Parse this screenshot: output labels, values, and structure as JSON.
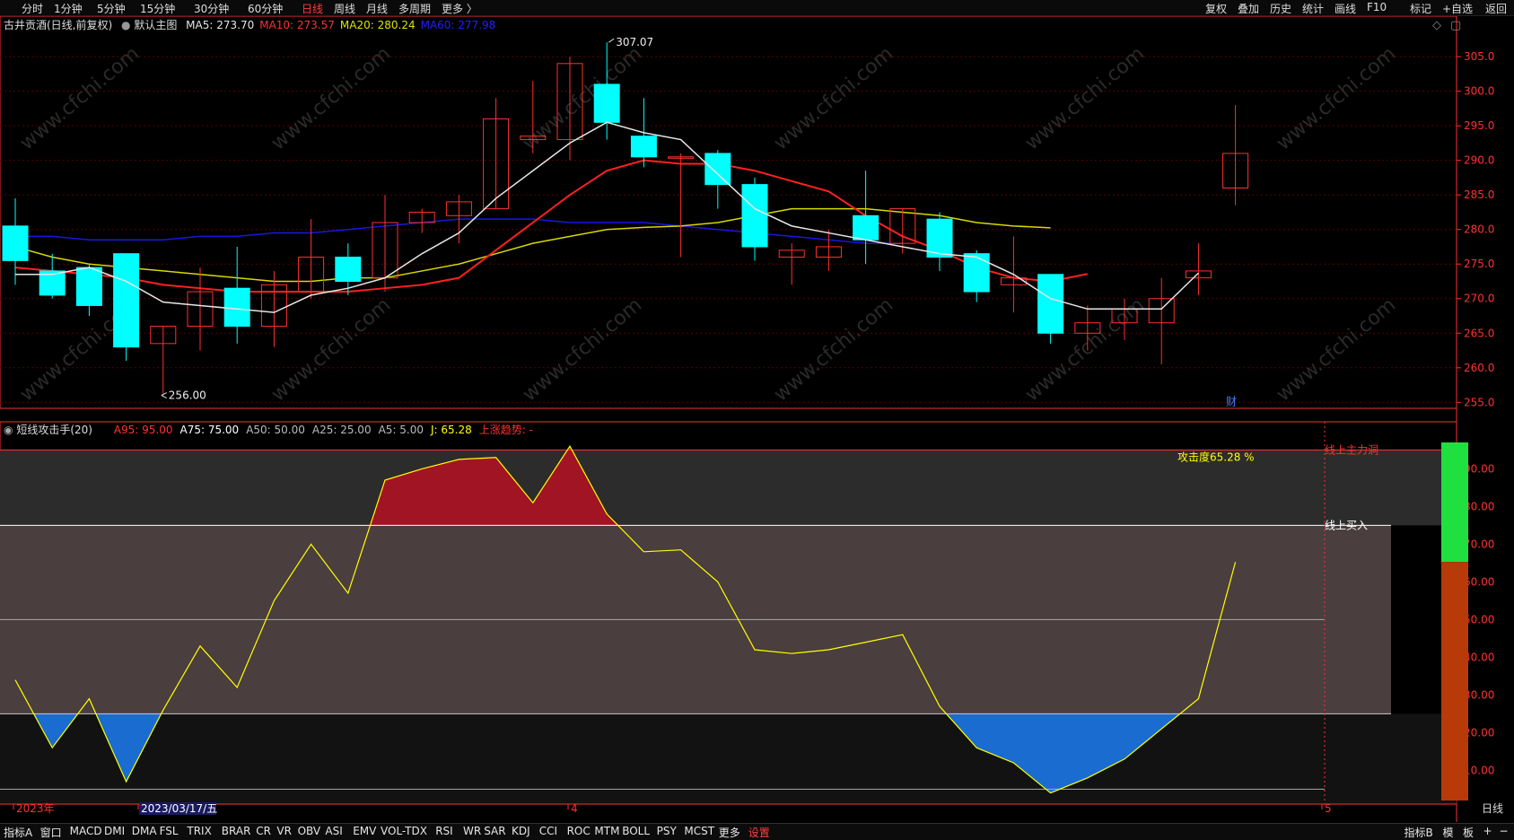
{
  "toolbar": {
    "periods": [
      "分时",
      "1分钟",
      "5分钟",
      "15分钟",
      "30分钟",
      "60分钟",
      "日线",
      "周线",
      "月线",
      "多周期",
      "更多 〉"
    ],
    "active_period": "日线",
    "right": [
      "复权",
      "叠加",
      "历史",
      "统计",
      "画线",
      "F10",
      "标记",
      "+自选",
      "返回"
    ]
  },
  "main_panel": {
    "stock_label": "古井贡酒(日线,前复权)",
    "template_label": "默认主图",
    "ma": [
      {
        "text": "MA5: 273.70",
        "color": "#e6e6e6"
      },
      {
        "text": "MA10: 273.57",
        "color": "#ff3030"
      },
      {
        "text": "MA20: 280.24",
        "color": "#e0e000"
      },
      {
        "text": "MA60: 277.98",
        "color": "#2020ff"
      }
    ],
    "high_marker": "307.07",
    "low_marker": "256.00",
    "fin_marker": "财"
  },
  "sub_panel": {
    "indicator_name": "短线攻击手(20)",
    "values": [
      {
        "text": "A95: 95.00",
        "color": "#ff3030"
      },
      {
        "text": "A75: 75.00",
        "color": "#ffffff"
      },
      {
        "text": "A50: 50.00",
        "color": "#bbbbbb"
      },
      {
        "text": "A25: 25.00",
        "color": "#bbbbbb"
      },
      {
        "text": "A5: 5.00",
        "color": "#bbbbbb"
      },
      {
        "text": "J: 65.28",
        "color": "#ffff00"
      },
      {
        "text": "上涨趋势: -",
        "color": "#ff3030"
      }
    ],
    "attack_label": "攻击度65.28 %",
    "buy_label": "线上买入",
    "top_label": "线上主力洞"
  },
  "date_axis": {
    "labels": [
      {
        "text": "2023年",
        "color": "#ff3030"
      },
      {
        "text": "2023/03/17/五",
        "color": "#ffffff"
      },
      {
        "text": "4",
        "color": "#ff3030"
      },
      {
        "text": "5",
        "color": "#ff3030"
      }
    ],
    "right_label": "日线"
  },
  "indicator_tabs": {
    "items": [
      "指标A",
      "窗口",
      "MACD",
      "DMI",
      "DMA",
      "FSL",
      "TRIX",
      "BRAR",
      "CR",
      "VR",
      "OBV",
      "ASI",
      "EMV",
      "VOL-TDX",
      "RSI",
      "WR",
      "SAR",
      "KDJ",
      "CCI",
      "ROC",
      "MTM",
      "BOLL",
      "PSY",
      "MCST",
      "更多",
      "设置"
    ],
    "right": [
      "指标B",
      "模",
      "板",
      "+",
      "−"
    ]
  },
  "watermark": "www.cfchi.com",
  "colors": {
    "up": "#ff3030",
    "down": "#00ffff",
    "grid": "#5a0000",
    "axis": "#ff3030",
    "ma5": "#e6e6e6",
    "ma10": "#ff2020",
    "ma20": "#d8d800",
    "ma60": "#1818e0",
    "j_line": "#ffff00",
    "fill_top": "#a01424",
    "fill_bottom": "#1a6cd0",
    "mid_band": "#4a3e3e"
  },
  "chart_data": [
    {
      "type": "candlestick",
      "title": "古井贡酒(日线,前复权)",
      "yticks": [
        255,
        260,
        265,
        270,
        275,
        280,
        285,
        290,
        295,
        300,
        305
      ],
      "ylim": [
        254,
        308
      ],
      "candles": [
        {
          "o": 280.5,
          "h": 284.5,
          "l": 272,
          "c": 275.5
        },
        {
          "o": 274,
          "h": 276.5,
          "l": 270,
          "c": 270.5
        },
        {
          "o": 274.5,
          "h": 275,
          "l": 267.5,
          "c": 269
        },
        {
          "o": 276.5,
          "h": 276.5,
          "l": 261,
          "c": 263
        },
        {
          "o": 263.5,
          "h": 266,
          "l": 256,
          "c": 266
        },
        {
          "o": 266,
          "h": 274.5,
          "l": 262.5,
          "c": 271
        },
        {
          "o": 271.5,
          "h": 277.5,
          "l": 263.5,
          "c": 266
        },
        {
          "o": 266,
          "h": 274,
          "l": 263,
          "c": 272
        },
        {
          "o": 271,
          "h": 281.5,
          "l": 270,
          "c": 276
        },
        {
          "o": 276,
          "h": 278,
          "l": 270.5,
          "c": 272.5
        },
        {
          "o": 273,
          "h": 285,
          "l": 271,
          "c": 281
        },
        {
          "o": 281,
          "h": 283,
          "l": 279.5,
          "c": 282.5
        },
        {
          "o": 282,
          "h": 285,
          "l": 278,
          "c": 284
        },
        {
          "o": 283,
          "h": 299,
          "l": 283,
          "c": 296
        },
        {
          "o": 293,
          "h": 301.5,
          "l": 291,
          "c": 293.5
        },
        {
          "o": 293,
          "h": 305,
          "l": 290,
          "c": 304
        },
        {
          "o": 301,
          "h": 307.07,
          "l": 293,
          "c": 295.5
        },
        {
          "o": 293.5,
          "h": 299,
          "l": 289,
          "c": 290.5
        },
        {
          "o": 290.5,
          "h": 291,
          "l": 276,
          "c": 290.5
        },
        {
          "o": 291,
          "h": 291.5,
          "l": 283,
          "c": 286.5
        },
        {
          "o": 286.5,
          "h": 287.5,
          "l": 275.5,
          "c": 277.5
        },
        {
          "o": 276,
          "h": 278,
          "l": 272,
          "c": 277
        },
        {
          "o": 276,
          "h": 280,
          "l": 274,
          "c": 277.5
        },
        {
          "o": 282,
          "h": 288.5,
          "l": 275,
          "c": 278.5
        },
        {
          "o": 278,
          "h": 283,
          "l": 276.5,
          "c": 283
        },
        {
          "o": 281.5,
          "h": 282.5,
          "l": 274,
          "c": 276
        },
        {
          "o": 276.5,
          "h": 277,
          "l": 269.5,
          "c": 271
        },
        {
          "o": 272,
          "h": 279,
          "l": 268,
          "c": 273
        },
        {
          "o": 273.5,
          "h": 273.5,
          "l": 263.5,
          "c": 265
        },
        {
          "o": 265,
          "h": 269,
          "l": 262.5,
          "c": 266.5
        },
        {
          "o": 266.5,
          "h": 270,
          "l": 264,
          "c": 268.5
        },
        {
          "o": 266.5,
          "h": 273,
          "l": 260.5,
          "c": 270
        },
        {
          "o": 273,
          "h": 278,
          "l": 270.5,
          "c": 274
        },
        {
          "o": 286,
          "h": 298,
          "l": 283.5,
          "c": 291
        }
      ],
      "ma5": [
        273.5,
        273.5,
        274.5,
        272.5,
        269.5,
        269,
        268.5,
        268,
        270.5,
        271.5,
        273,
        276.5,
        279.5,
        284.5,
        288.5,
        292.5,
        295.5,
        294,
        293,
        288,
        283,
        280.5,
        279.5,
        278.5,
        277.5,
        276.5,
        276,
        273.5,
        270,
        268.5,
        268.5,
        268.5,
        273.7
      ],
      "ma10": [
        274.5,
        274,
        273.5,
        273,
        272,
        271.5,
        271,
        271,
        271,
        271,
        271.5,
        272,
        273,
        277,
        281,
        285,
        288.5,
        290,
        289.5,
        289.5,
        288.5,
        287,
        285.5,
        282,
        279,
        277,
        274.5,
        273,
        272.5,
        273.57
      ],
      "ma20": [
        277.5,
        276,
        275,
        274.5,
        274,
        273.5,
        273,
        272.5,
        272.5,
        273,
        273,
        274,
        275,
        276.5,
        278,
        279,
        280,
        280.3,
        280.5,
        281,
        282,
        283,
        283,
        283,
        282.5,
        282,
        281,
        280.5,
        280.24
      ],
      "ma60": [
        279,
        279,
        278.5,
        278.5,
        278.5,
        279,
        279,
        279.5,
        279.5,
        280,
        280.5,
        281,
        281.5,
        281.5,
        281.5,
        281,
        281,
        281,
        280.5,
        280,
        279.5,
        279,
        278.5,
        278,
        277.98
      ]
    },
    {
      "type": "area",
      "title": "短线攻击手(20)",
      "yticks": [
        10,
        20,
        30,
        40,
        50,
        60,
        70,
        80,
        90
      ],
      "ylim": [
        2,
        97
      ],
      "hlines": [
        95,
        75,
        50,
        25,
        5
      ],
      "j": [
        34,
        16,
        29,
        7,
        26,
        43,
        32,
        55,
        70,
        57,
        87,
        90,
        92.5,
        93,
        81,
        96,
        78,
        68,
        68.5,
        60,
        42,
        41,
        42,
        44,
        46,
        27,
        16,
        12,
        4,
        8,
        13,
        21,
        29,
        65.28
      ],
      "gauge_level": 65.28
    }
  ]
}
